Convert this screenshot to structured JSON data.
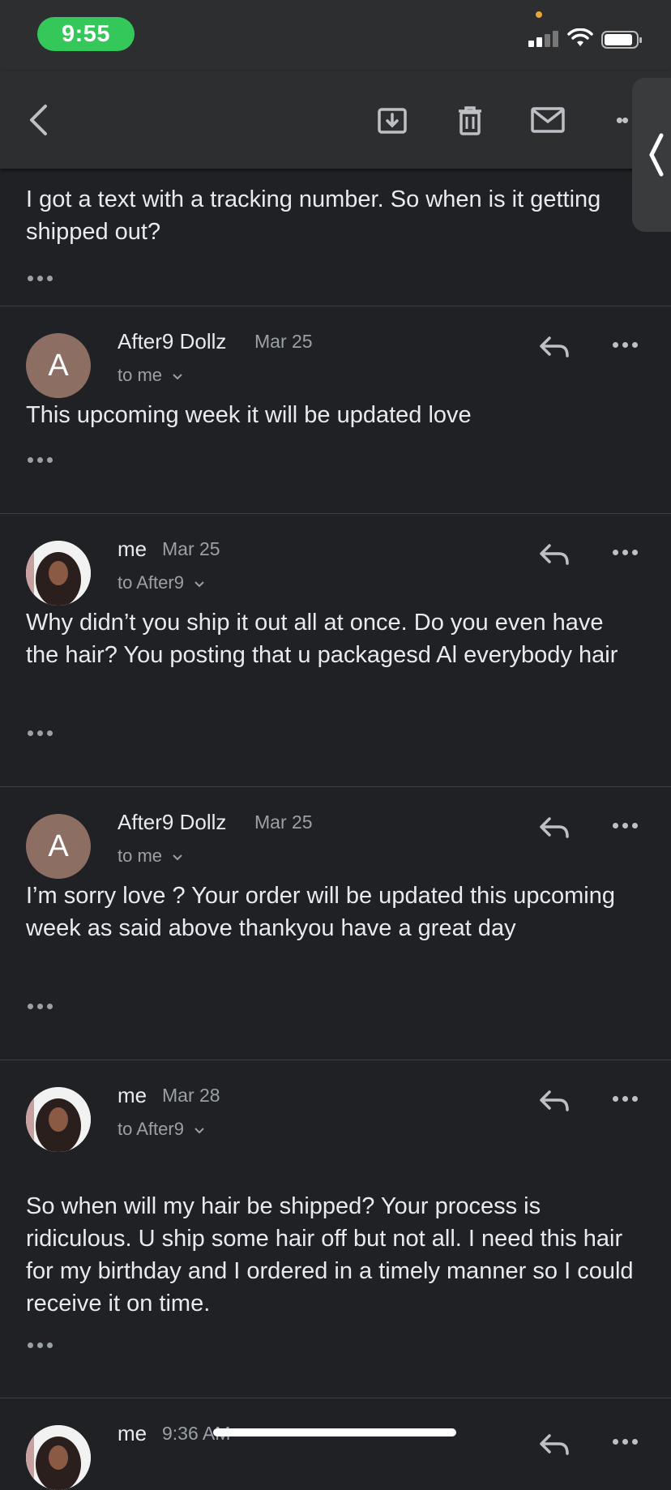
{
  "status_bar": {
    "time": "9:55"
  },
  "partial_top": {
    "body": "I got a text with a tracking number. So when is it getting shipped out?"
  },
  "messages": [
    {
      "avatar": "A",
      "sender": "After9 Dollz",
      "date": "Mar 25",
      "to": "to me",
      "body": "This upcoming week it will be updated love"
    },
    {
      "avatar": "photo",
      "sender": "me",
      "date": "Mar 25",
      "to": "to After9",
      "body": "Why didn’t you ship it out all at once. Do you even have the hair? You posting that u packagesd Al everybody hair"
    },
    {
      "avatar": "A",
      "sender": "After9 Dollz",
      "date": "Mar 25",
      "to": "to me",
      "body": "I’m sorry love ? Your order will be updated this upcoming week as said above thankyou have a great day"
    },
    {
      "avatar": "photo",
      "sender": "me",
      "date": "Mar 28",
      "to": "to After9",
      "body": "So when will my hair be shipped? Your process is ridiculous. U ship some hair off but not all. I need this hair for my birthday and I ordered in a timely manner so I could receive it on time."
    },
    {
      "avatar": "photo",
      "sender": "me",
      "date": "9:36 AM"
    }
  ],
  "icons": [
    "back-icon",
    "archive-icon",
    "trash-icon",
    "mail-icon",
    "more-icon",
    "reply-icon",
    "chevron-down-icon"
  ]
}
